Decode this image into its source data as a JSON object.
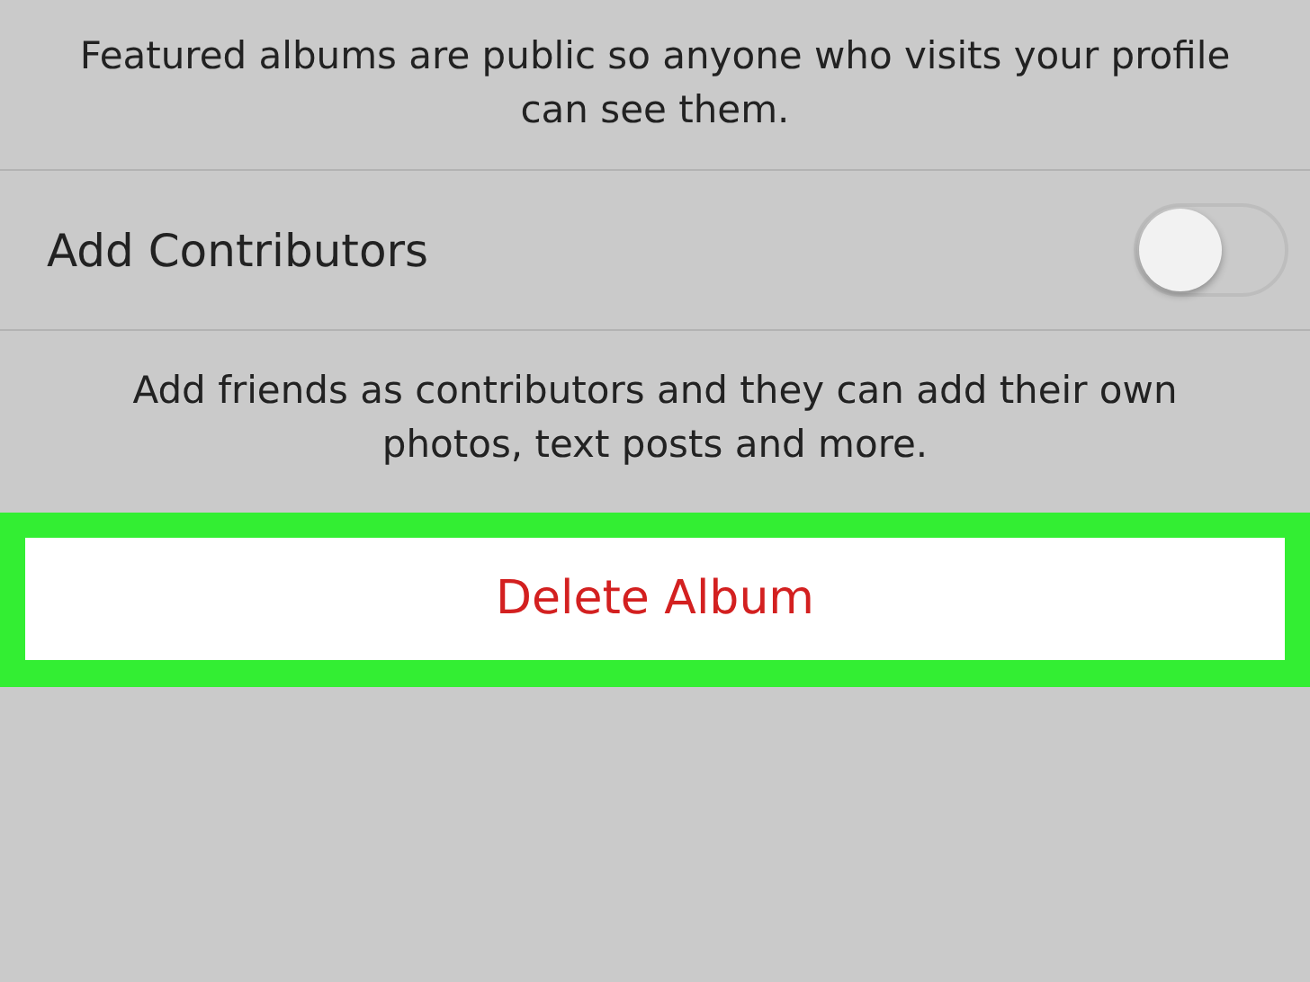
{
  "featured_note": "Featured albums are public so anyone who visits your profile can see them.",
  "contributors": {
    "label": "Add Contributors",
    "on": false
  },
  "contributors_note": "Add friends as contributors and they can add their own photos, text posts and more.",
  "delete_button": {
    "label": "Delete Album"
  }
}
